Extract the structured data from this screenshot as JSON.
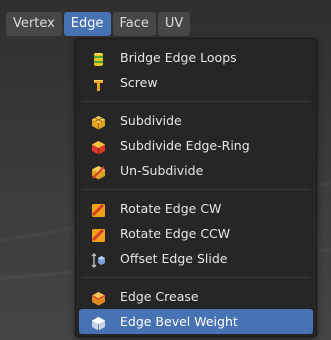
{
  "menubar": {
    "tabs": [
      "Vertex",
      "Edge",
      "Face",
      "UV"
    ],
    "active_tab": "Edge"
  },
  "dropdown": {
    "groups": [
      [
        {
          "label": "Bridge Edge Loops",
          "icon": "bridge-edge-loops-icon"
        },
        {
          "label": "Screw",
          "icon": "screw-icon"
        }
      ],
      [
        {
          "label": "Subdivide",
          "icon": "subdivide-icon"
        },
        {
          "label": "Subdivide Edge-Ring",
          "icon": "subdivide-edge-ring-icon"
        },
        {
          "label": "Un-Subdivide",
          "icon": "un-subdivide-icon"
        }
      ],
      [
        {
          "label": "Rotate Edge CW",
          "icon": "rotate-edge-cw-icon"
        },
        {
          "label": "Rotate Edge CCW",
          "icon": "rotate-edge-ccw-icon"
        },
        {
          "label": "Offset Edge Slide",
          "icon": "offset-edge-slide-icon"
        }
      ],
      [
        {
          "label": "Edge Crease",
          "icon": "edge-crease-icon"
        },
        {
          "label": "Edge Bevel Weight",
          "icon": "edge-bevel-weight-icon"
        }
      ]
    ],
    "highlighted_item": "Edge Bevel Weight"
  },
  "colors": {
    "accent": "#4772b3",
    "menu_bg": "#262626",
    "tab_bg": "#474747"
  }
}
